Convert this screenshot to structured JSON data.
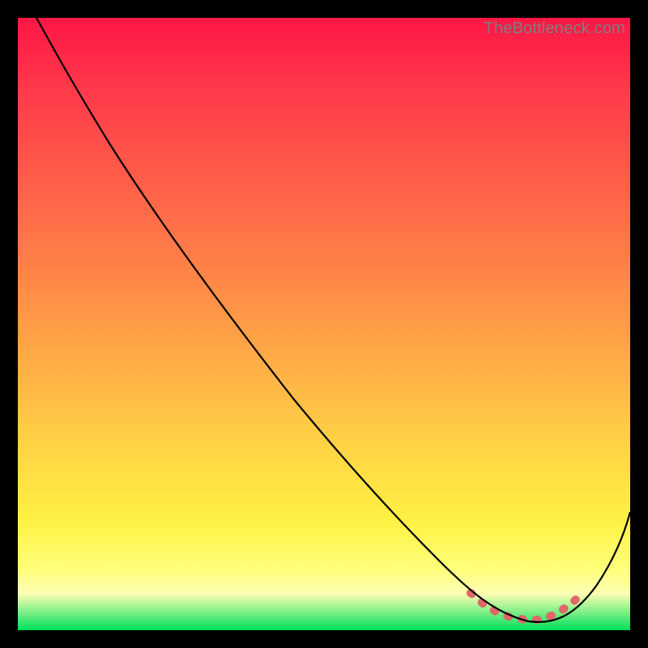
{
  "watermark": "TheBottleneck.com",
  "chart_data": {
    "type": "line",
    "title": "",
    "xlabel": "",
    "ylabel": "",
    "xlim": [
      0,
      100
    ],
    "ylim": [
      0,
      100
    ],
    "series": [
      {
        "name": "curve",
        "x": [
          3,
          8,
          15,
          25,
          35,
          45,
          55,
          63,
          70,
          75,
          79,
          82,
          85,
          88,
          91,
          94,
          97,
          100
        ],
        "y": [
          100,
          97,
          91,
          79,
          66,
          53,
          40,
          30,
          20,
          12,
          6,
          3,
          1.5,
          1.5,
          3,
          7,
          13,
          21
        ]
      }
    ],
    "highlight_range_x": [
      74,
      93
    ],
    "background_gradient": {
      "top": "#ff1646",
      "mid1": "#ff8547",
      "mid2": "#fff143",
      "bottom": "#00e05b"
    }
  }
}
